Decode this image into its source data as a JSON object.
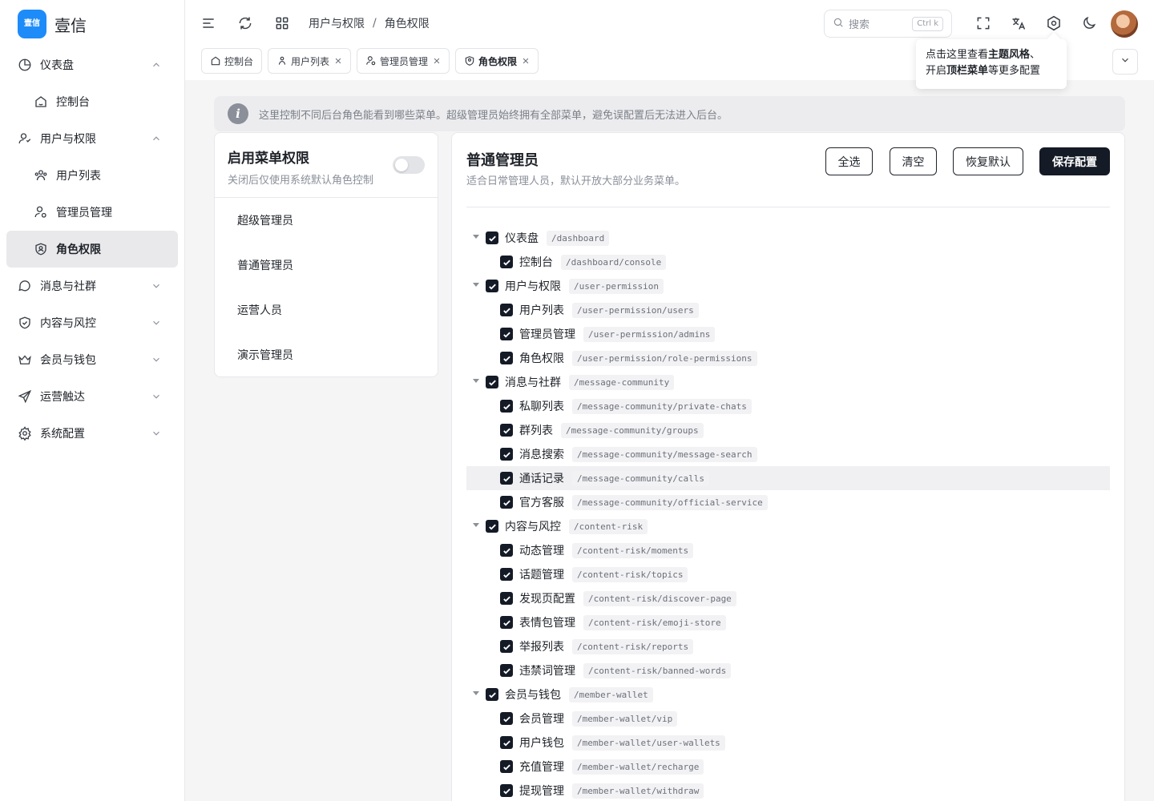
{
  "brand": {
    "logo_text": "壹信",
    "name": "壹信"
  },
  "sidebar": {
    "items": [
      {
        "label": "仪表盘",
        "icon": "pie-chart-icon",
        "expanded": true
      },
      {
        "label": "控制台",
        "icon": "home-icon"
      },
      {
        "label": "用户与权限",
        "icon": "user-icon",
        "expanded": true
      },
      {
        "label": "用户列表",
        "icon": "users-icon"
      },
      {
        "label": "管理员管理",
        "icon": "user-gear-icon"
      },
      {
        "label": "角色权限",
        "icon": "shield-user-icon",
        "active": true
      },
      {
        "label": "消息与社群",
        "icon": "message-icon",
        "expanded": false
      },
      {
        "label": "内容与风控",
        "icon": "shield-check-icon",
        "expanded": false
      },
      {
        "label": "会员与钱包",
        "icon": "crown-icon",
        "expanded": false
      },
      {
        "label": "运营触达",
        "icon": "send-icon",
        "expanded": false
      },
      {
        "label": "系统配置",
        "icon": "gear-icon",
        "expanded": false
      }
    ]
  },
  "header": {
    "breadcrumb": [
      "用户与权限",
      "角色权限"
    ],
    "breadcrumb_sep": "/",
    "search": {
      "placeholder": "搜索",
      "shortcut": "Ctrl k"
    },
    "tooltip": {
      "line1_pre": "点击这里查看",
      "line1_bold": "主题风格",
      "line1_post": "、",
      "line2_pre": "开启",
      "line2_bold": "顶栏菜单",
      "line2_post": "等更多配置"
    }
  },
  "tabs": [
    {
      "label": "控制台",
      "icon": "home-icon",
      "closable": false
    },
    {
      "label": "用户列表",
      "icon": "users-icon",
      "closable": true
    },
    {
      "label": "管理员管理",
      "icon": "user-gear-icon",
      "closable": true
    },
    {
      "label": "角色权限",
      "icon": "shield-user-icon",
      "closable": true,
      "active": true
    }
  ],
  "notice": {
    "text": "这里控制不同后台角色能看到哪些菜单。超级管理员始终拥有全部菜单，避免误配置后无法进入后台。"
  },
  "left_panel": {
    "title": "启用菜单权限",
    "subtitle": "关闭后仅使用系统默认角色控制",
    "toggle_on": false,
    "roles": [
      "超级管理员",
      "普通管理员",
      "运营人员",
      "演示管理员"
    ]
  },
  "right_panel": {
    "title": "普通管理员",
    "subtitle": "适合日常管理人员，默认开放大部分业务菜单。",
    "buttons": {
      "select_all": "全选",
      "clear": "清空",
      "reset": "恢复默认",
      "save": "保存配置"
    },
    "tree": [
      {
        "level": 0,
        "name": "仪表盘",
        "path": "/dashboard",
        "checked": true
      },
      {
        "level": 1,
        "name": "控制台",
        "path": "/dashboard/console",
        "checked": true
      },
      {
        "level": 0,
        "name": "用户与权限",
        "path": "/user-permission",
        "checked": true
      },
      {
        "level": 1,
        "name": "用户列表",
        "path": "/user-permission/users",
        "checked": true
      },
      {
        "level": 1,
        "name": "管理员管理",
        "path": "/user-permission/admins",
        "checked": true
      },
      {
        "level": 1,
        "name": "角色权限",
        "path": "/user-permission/role-permissions",
        "checked": true
      },
      {
        "level": 0,
        "name": "消息与社群",
        "path": "/message-community",
        "checked": true
      },
      {
        "level": 1,
        "name": "私聊列表",
        "path": "/message-community/private-chats",
        "checked": true
      },
      {
        "level": 1,
        "name": "群列表",
        "path": "/message-community/groups",
        "checked": true
      },
      {
        "level": 1,
        "name": "消息搜索",
        "path": "/message-community/message-search",
        "checked": true
      },
      {
        "level": 1,
        "name": "通话记录",
        "path": "/message-community/calls",
        "checked": true,
        "highlight": true
      },
      {
        "level": 1,
        "name": "官方客服",
        "path": "/message-community/official-service",
        "checked": true
      },
      {
        "level": 0,
        "name": "内容与风控",
        "path": "/content-risk",
        "checked": true
      },
      {
        "level": 1,
        "name": "动态管理",
        "path": "/content-risk/moments",
        "checked": true
      },
      {
        "level": 1,
        "name": "话题管理",
        "path": "/content-risk/topics",
        "checked": true
      },
      {
        "level": 1,
        "name": "发现页配置",
        "path": "/content-risk/discover-page",
        "checked": true
      },
      {
        "level": 1,
        "name": "表情包管理",
        "path": "/content-risk/emoji-store",
        "checked": true
      },
      {
        "level": 1,
        "name": "举报列表",
        "path": "/content-risk/reports",
        "checked": true
      },
      {
        "level": 1,
        "name": "违禁词管理",
        "path": "/content-risk/banned-words",
        "checked": true
      },
      {
        "level": 0,
        "name": "会员与钱包",
        "path": "/member-wallet",
        "checked": true
      },
      {
        "level": 1,
        "name": "会员管理",
        "path": "/member-wallet/vip",
        "checked": true
      },
      {
        "level": 1,
        "name": "用户钱包",
        "path": "/member-wallet/user-wallets",
        "checked": true
      },
      {
        "level": 1,
        "name": "充值管理",
        "path": "/member-wallet/recharge",
        "checked": true
      },
      {
        "level": 1,
        "name": "提现管理",
        "path": "/member-wallet/withdraw",
        "checked": true
      }
    ]
  }
}
